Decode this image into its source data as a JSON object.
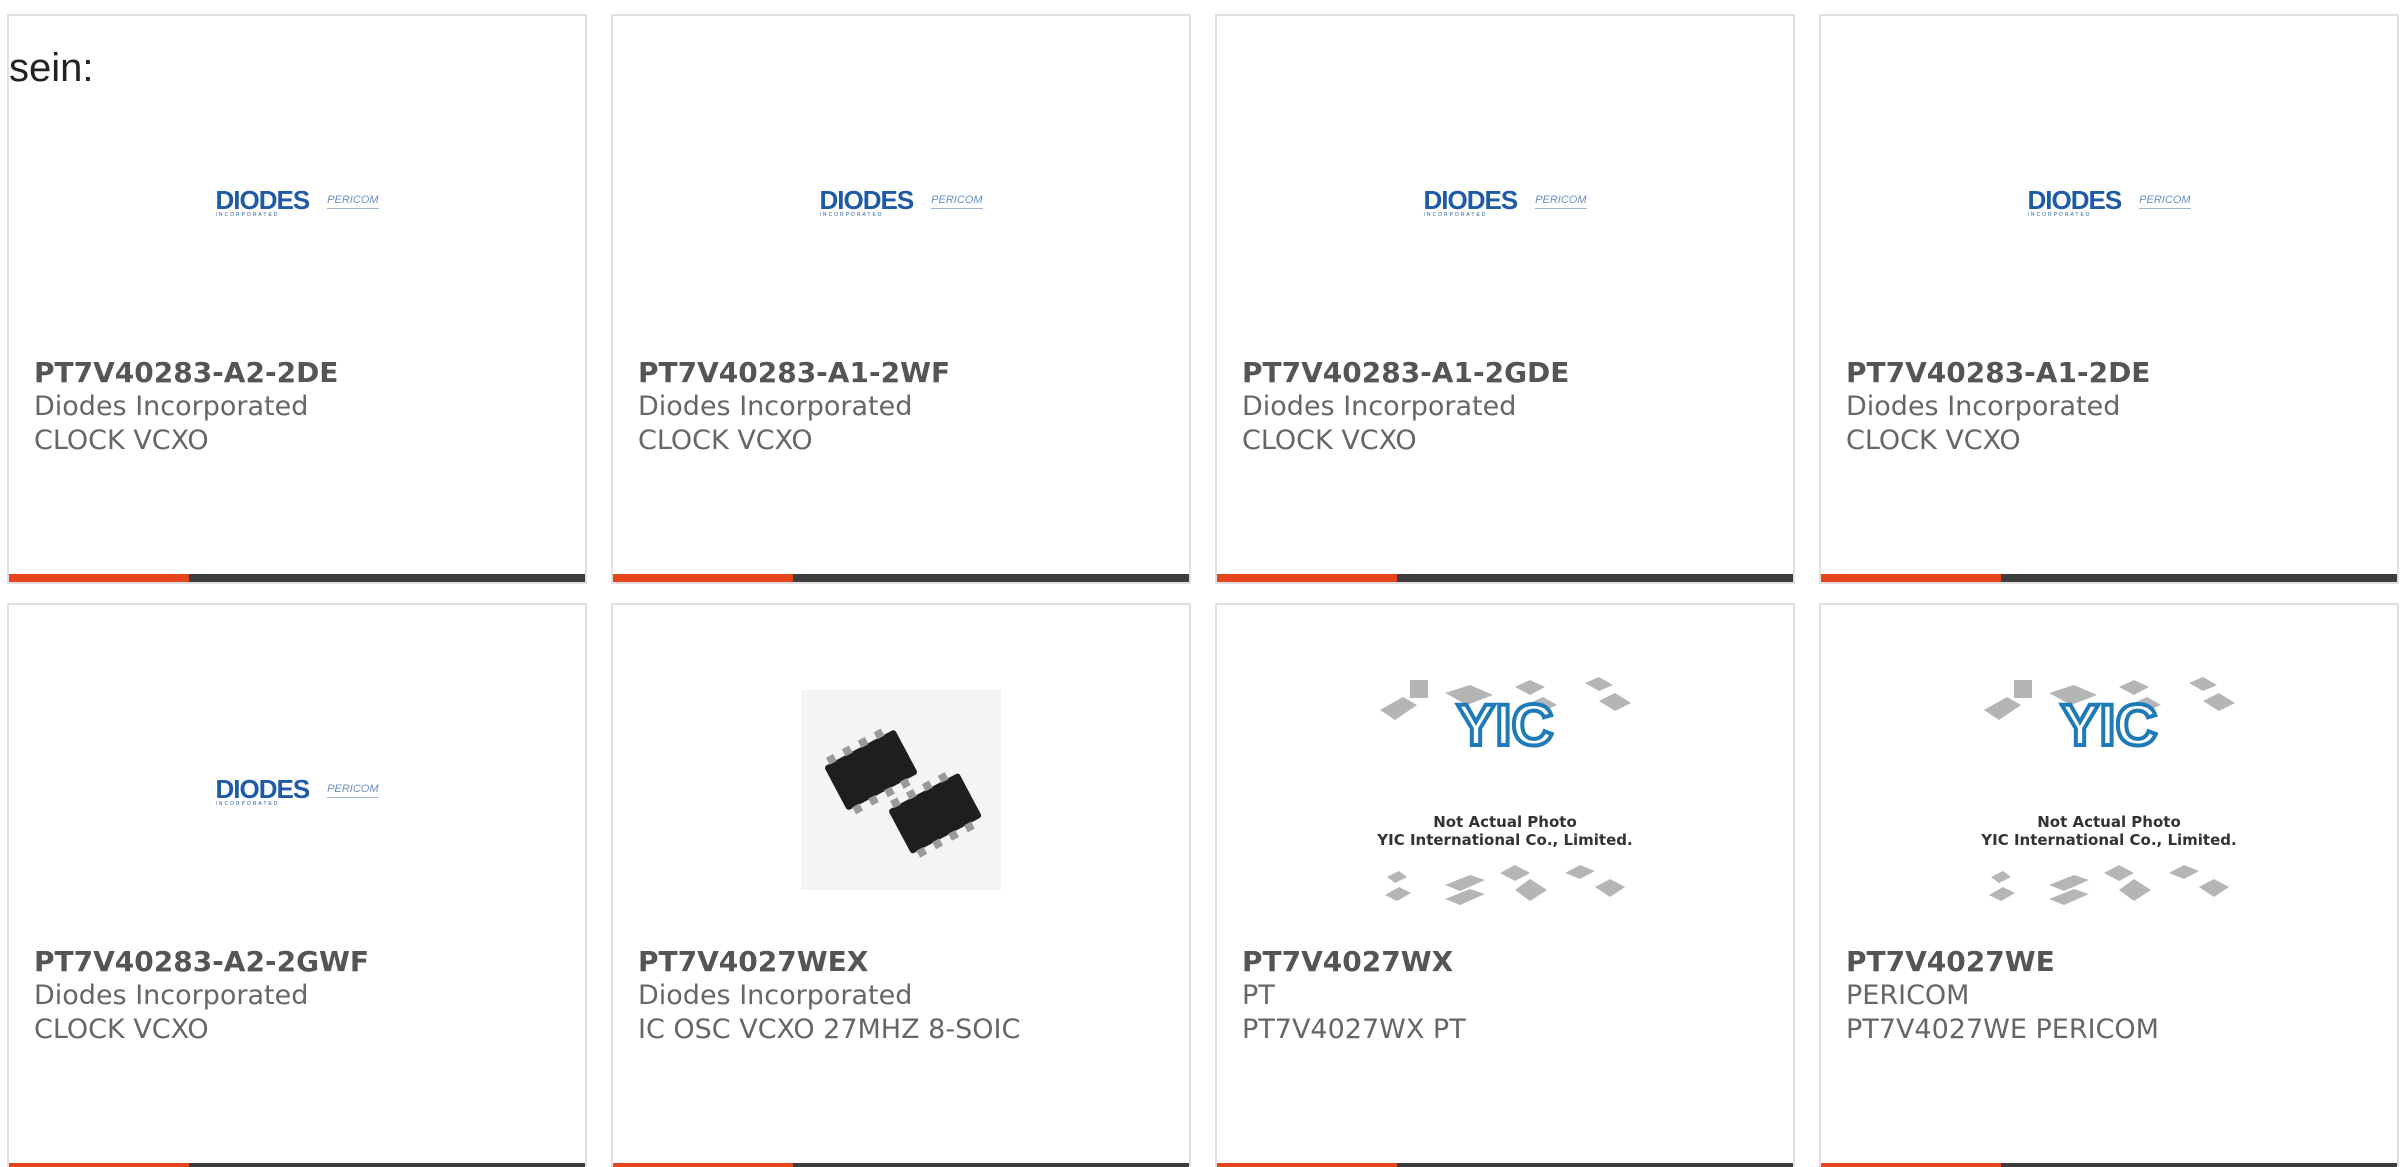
{
  "intro_text": "sein:",
  "cards": [
    {
      "part": "PT7V40283-A2-2DE",
      "mfr": "Diodes Incorporated",
      "desc": "CLOCK VCXO",
      "image": "diodes-pericom-logo"
    },
    {
      "part": "PT7V40283-A1-2WF",
      "mfr": "Diodes Incorporated",
      "desc": "CLOCK VCXO",
      "image": "diodes-pericom-logo"
    },
    {
      "part": "PT7V40283-A1-2GDE",
      "mfr": "Diodes Incorporated",
      "desc": "CLOCK VCXO",
      "image": "diodes-pericom-logo"
    },
    {
      "part": "PT7V40283-A1-2DE",
      "mfr": "Diodes Incorporated",
      "desc": "CLOCK VCXO",
      "image": "diodes-pericom-logo"
    },
    {
      "part": "PT7V40283-A2-2GWF",
      "mfr": "Diodes Incorporated",
      "desc": "CLOCK VCXO",
      "image": "diodes-pericom-logo"
    },
    {
      "part": "PT7V4027WEX",
      "mfr": "Diodes Incorporated",
      "desc": "IC OSC VCXO 27MHZ 8-SOIC",
      "image": "soic-chip-photo"
    },
    {
      "part": "PT7V4027WX",
      "mfr": "PT",
      "desc": "PT7V4027WX PT",
      "image": "not-actual-photo-placeholder"
    },
    {
      "part": "PT7V4027WE",
      "mfr": "PERICOM",
      "desc": "PT7V4027WE PERICOM",
      "image": "not-actual-photo-placeholder"
    }
  ],
  "logo": {
    "brand": "DIODES",
    "sub": "INCORPORATED",
    "partner": "PERICOM"
  },
  "placeholder": {
    "brand": "YIC",
    "line1": "Not Actual Photo",
    "line2": "YIC International Co., Limited."
  },
  "colors": {
    "accent": "#e8441e",
    "bar": "#3d3d3d",
    "text": "#555555",
    "logo_blue": "#1f5aa6"
  }
}
